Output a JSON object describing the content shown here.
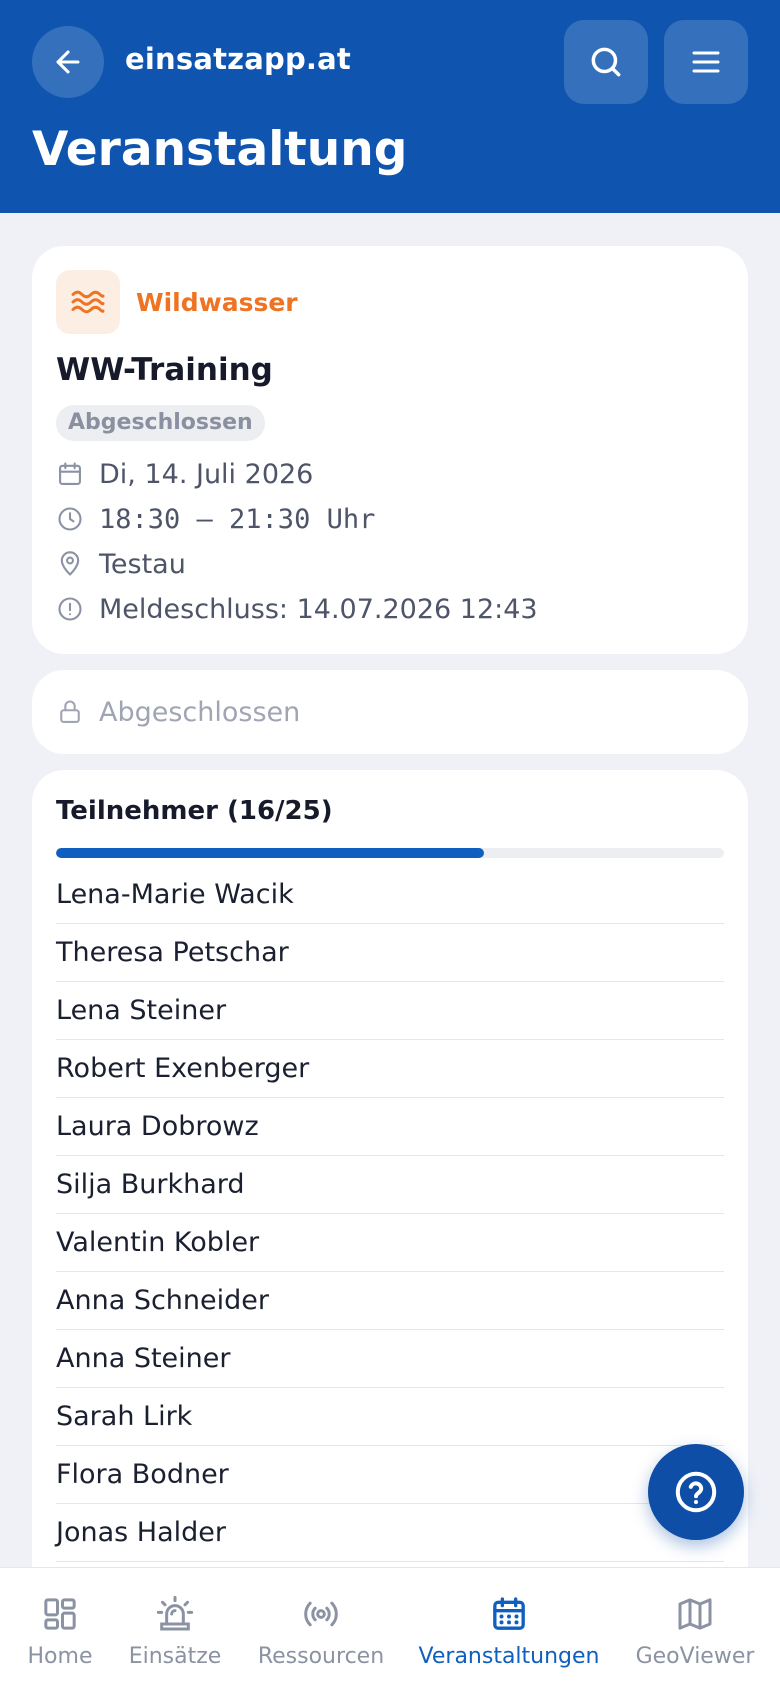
{
  "header": {
    "brand": "einsatzapp.at",
    "page_title": "Veranstaltung"
  },
  "event": {
    "category": "Wildwasser",
    "title": "WW-Training",
    "status": "Abgeschlossen",
    "date": "Di, 14. Juli 2026",
    "time": "18:30 – 21:30 Uhr",
    "location": "Testau",
    "deadline": "Meldeschluss: 14.07.2026 12:43"
  },
  "registration": {
    "state_label": "Abgeschlossen"
  },
  "participants": {
    "title": "Teilnehmer (16/25)",
    "count": 16,
    "capacity": 25,
    "fill_fraction": 0.64,
    "names": [
      "Lena-Marie Wacik",
      "Theresa Petschar",
      "Lena Steiner",
      "Robert Exenberger",
      "Laura Dobrowz",
      "Silja Burkhard",
      "Valentin Kobler",
      "Anna Schneider",
      "Anna Steiner",
      "Sarah Lirk",
      "Flora Bodner",
      "Jonas Halder"
    ]
  },
  "nav": {
    "home": "Home",
    "einsaetze": "Einsätze",
    "ressourcen": "Ressourcen",
    "veranstaltungen": "Veranstaltungen",
    "geoviewer": "GeoViewer"
  },
  "icons": {
    "back": "arrow-left-icon",
    "search": "search-icon",
    "menu": "hamburger-menu-icon",
    "category": "waves-icon",
    "date": "calendar-icon",
    "time": "clock-icon",
    "location": "map-pin-icon",
    "deadline": "alert-circle-icon",
    "lock": "lock-icon",
    "help": "help-circle-icon"
  },
  "colors": {
    "header_bg": "#0f55b0",
    "accent": "#0f5fbf",
    "category": "#ee7424",
    "page_bg": "#eff1f6"
  }
}
